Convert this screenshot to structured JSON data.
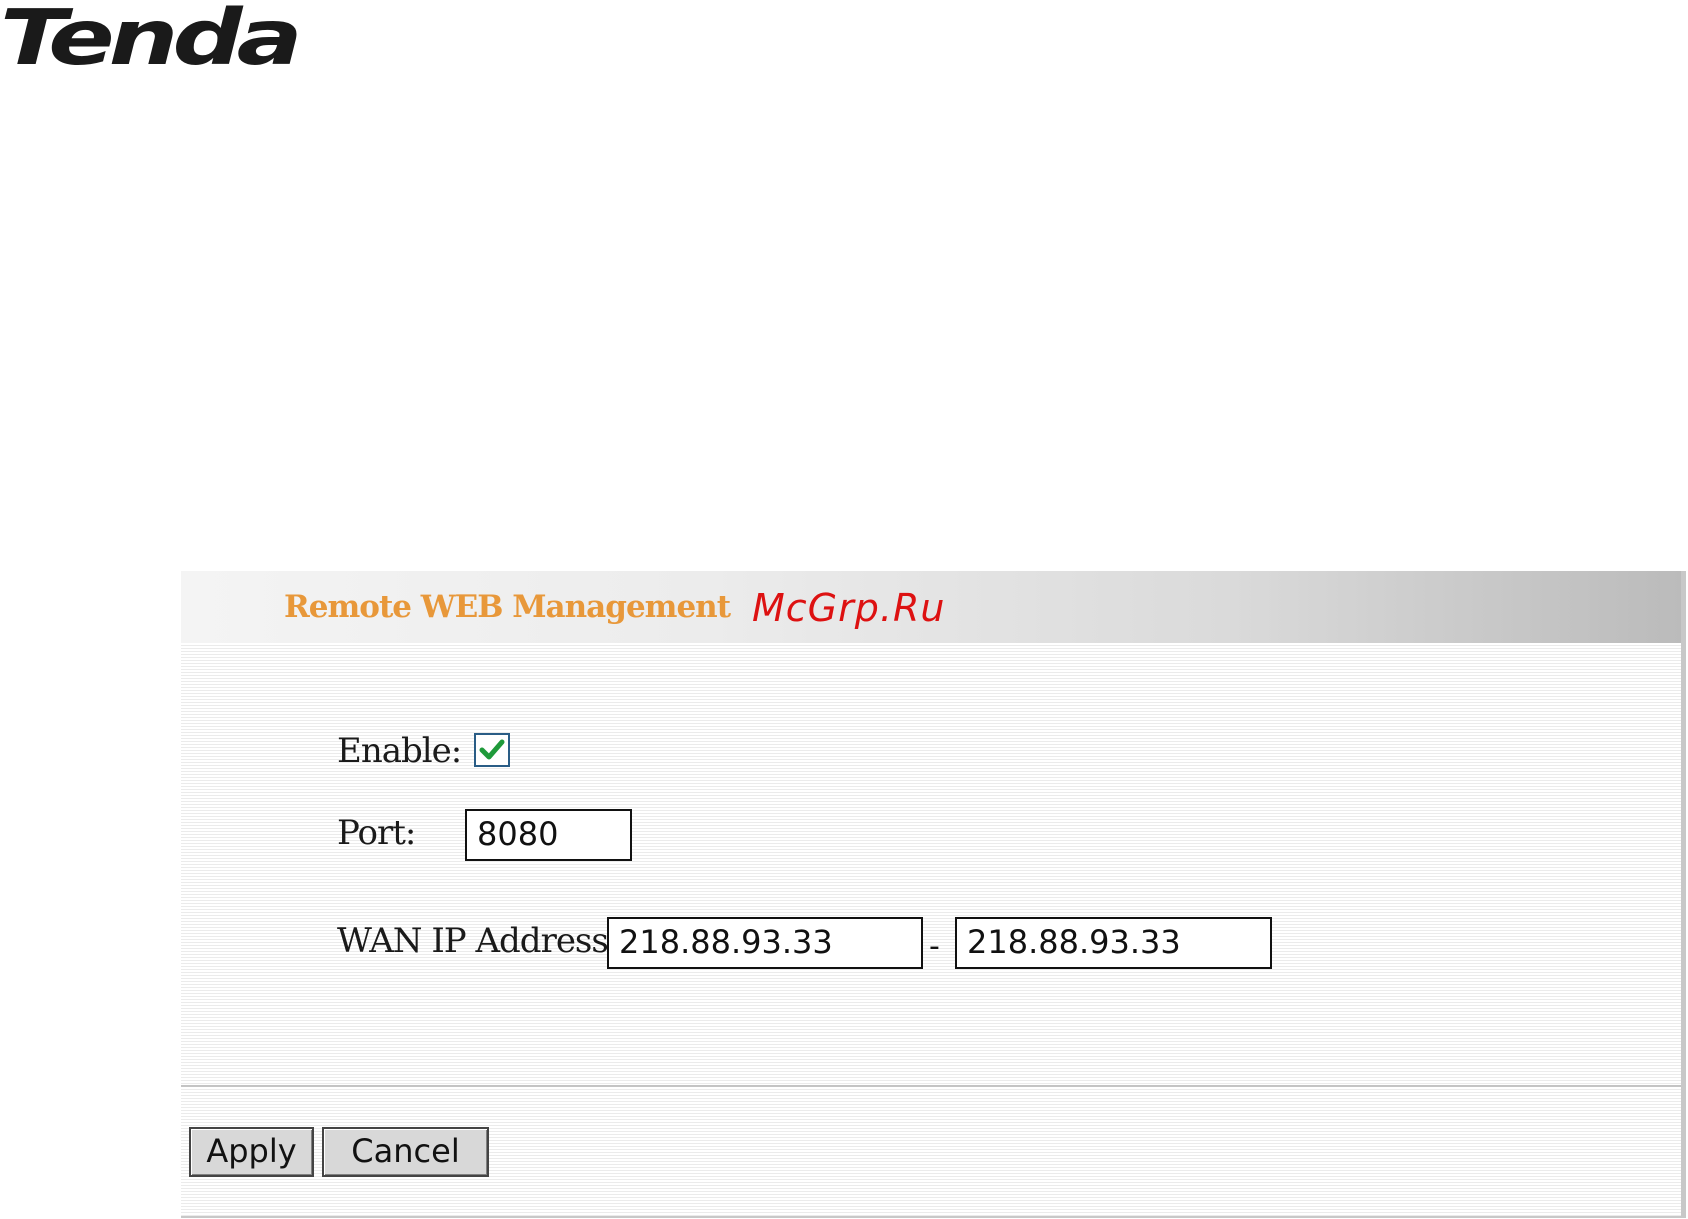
{
  "brand": {
    "logo_text": "Tenda",
    "registered_mark": "®"
  },
  "panel": {
    "title": "Remote WEB Management",
    "watermark": "McGrp.Ru"
  },
  "form": {
    "enable_label": "Enable:",
    "enable_checked": true,
    "port_label": "Port:",
    "port_value": "8080",
    "wan_ip_label": "WAN IP Address:",
    "wan_ip_start": "218.88.93.33",
    "range_separator": "-",
    "wan_ip_end": "218.88.93.33"
  },
  "buttons": {
    "apply_label": "Apply",
    "cancel_label": "Cancel"
  },
  "colors": {
    "title": "#e8983a",
    "watermark": "#dd1111",
    "checkmark": "#1f9a3a",
    "checkbox_border": "#2a5d86"
  },
  "icons": {
    "checkbox": "checkmark-icon"
  }
}
